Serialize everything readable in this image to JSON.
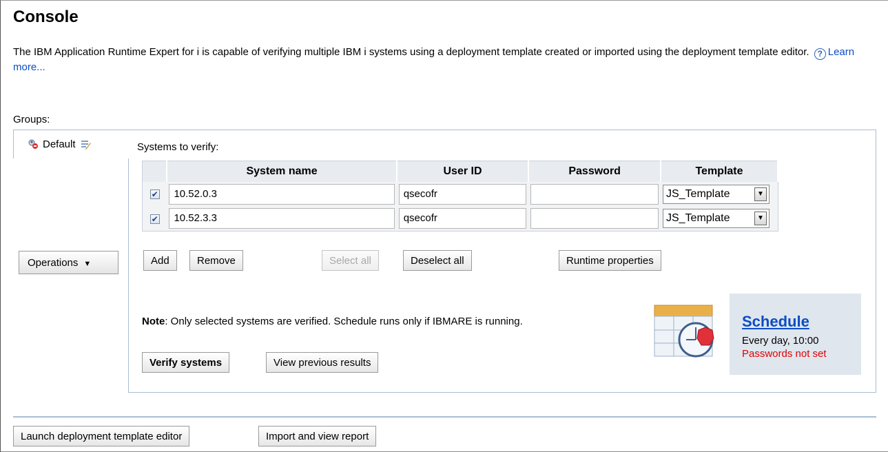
{
  "page": {
    "title": "Console",
    "intro_text": "The IBM Application Runtime Expert for i is capable of verifying multiple IBM i systems using a deployment template created or imported using the deployment template editor.",
    "learn_more": "Learn more...",
    "groups_label": "Groups:"
  },
  "group": {
    "name": "Default",
    "operations_label": "Operations",
    "default_icon": "group-people-icon",
    "edit_icon": "edit-pencil-icon"
  },
  "systems": {
    "label": "Systems to verify:",
    "columns": [
      "",
      "System name",
      "User ID",
      "Password",
      "Template"
    ],
    "rows": [
      {
        "checked": true,
        "system_name": "10.52.0.3",
        "user_id": "qsecofr",
        "password": "",
        "template": "JS_Template"
      },
      {
        "checked": true,
        "system_name": "10.52.3.3",
        "user_id": "qsecofr",
        "password": "",
        "template": "JS_Template"
      }
    ]
  },
  "buttons": {
    "add": "Add",
    "remove": "Remove",
    "select_all": "Select all",
    "deselect_all": "Deselect all",
    "runtime_properties": "Runtime properties",
    "verify_systems": "Verify systems",
    "view_previous_results": "View previous results",
    "launch_editor": "Launch deployment template editor",
    "import_report": "Import and view report"
  },
  "note": {
    "bold": "Note",
    "text": ": Only selected systems are verified. Schedule runs only if IBMARE is running."
  },
  "schedule": {
    "title": "Schedule",
    "frequency": "Every day, 10:00",
    "warning": "Passwords not set",
    "warning_color": "#e00000"
  },
  "colors": {
    "link": "#0b4dc4",
    "panel_border": "#a8bdd3",
    "schedule_bg": "#dfe6ee"
  }
}
